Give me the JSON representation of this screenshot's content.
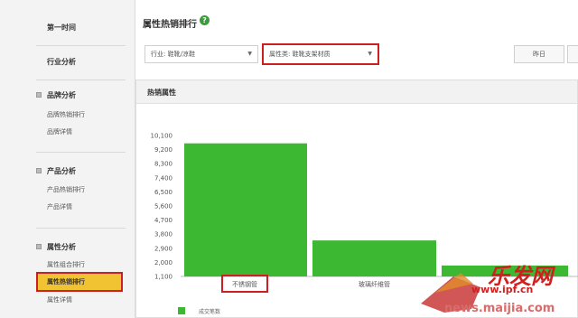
{
  "sidebar": {
    "top_item": "第一时间",
    "industry": "行业分析",
    "sections": [
      {
        "title": "品牌分析",
        "items": [
          "品牌热销排行",
          "品牌详情"
        ]
      },
      {
        "title": "产品分析",
        "items": [
          "产品热销排行",
          "产品详情"
        ]
      },
      {
        "title": "属性分析",
        "items": [
          "属性组合排行",
          "属性热销排行",
          "属性详情"
        ]
      }
    ],
    "active_item": "属性热销排行"
  },
  "header": {
    "title": "属性热销排行",
    "help_icon": "question-icon"
  },
  "filters": {
    "industry": "行业: 鞋靴/凉鞋",
    "attribute": "属性类: 鞋靴支架材质",
    "date": "昨日"
  },
  "panel": {
    "title": "热销属性"
  },
  "colors": {
    "bar": "#3cb832",
    "highlight": "#cc1f1f",
    "active_bg": "#f1c232"
  },
  "chart_data": {
    "type": "bar",
    "categories": [
      "不锈钢管",
      "玻璃纤维管",
      ""
    ],
    "values": [
      9600,
      3400,
      1800
    ],
    "ylim": [
      1100,
      10100
    ],
    "yticks": [
      "10,100",
      "9,200",
      "8,300",
      "7,400",
      "6,500",
      "5,600",
      "4,700",
      "3,800",
      "2,900",
      "2,000",
      "1,100"
    ],
    "legend": "成交笔数"
  },
  "watermark": {
    "brand": "乐发网",
    "domain": "www.ipf.cn",
    "news": "news.maijia.com"
  }
}
